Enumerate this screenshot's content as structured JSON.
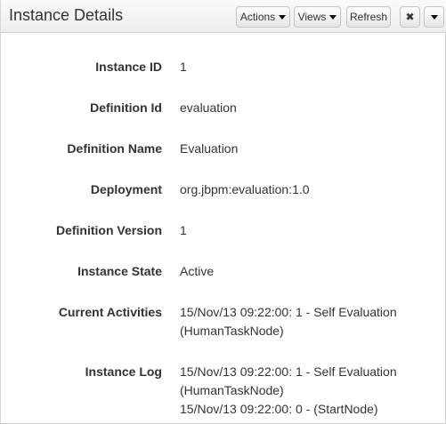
{
  "header": {
    "title": "Instance Details",
    "actions_label": "Actions",
    "views_label": "Views",
    "refresh_label": "Refresh"
  },
  "fields": {
    "instance_id": {
      "label": "Instance ID",
      "value": "1"
    },
    "definition_id": {
      "label": "Definition Id",
      "value": "evaluation"
    },
    "definition_name": {
      "label": "Definition Name",
      "value": "Evaluation"
    },
    "deployment": {
      "label": "Deployment",
      "value": "org.jbpm:evaluation:1.0"
    },
    "definition_version": {
      "label": "Definition Version",
      "value": "1"
    },
    "instance_state": {
      "label": "Instance State",
      "value": "Active"
    },
    "current_activities": {
      "label": "Current Activities",
      "lines": [
        "15/Nov/13 09:22:00: 1 - Self Evaluation",
        "(HumanTaskNode)"
      ]
    },
    "instance_log": {
      "label": "Instance Log",
      "lines": [
        "15/Nov/13 09:22:00: 1 - Self Evaluation",
        "(HumanTaskNode)",
        "15/Nov/13 09:22:00: 0 - (StartNode)"
      ]
    }
  }
}
